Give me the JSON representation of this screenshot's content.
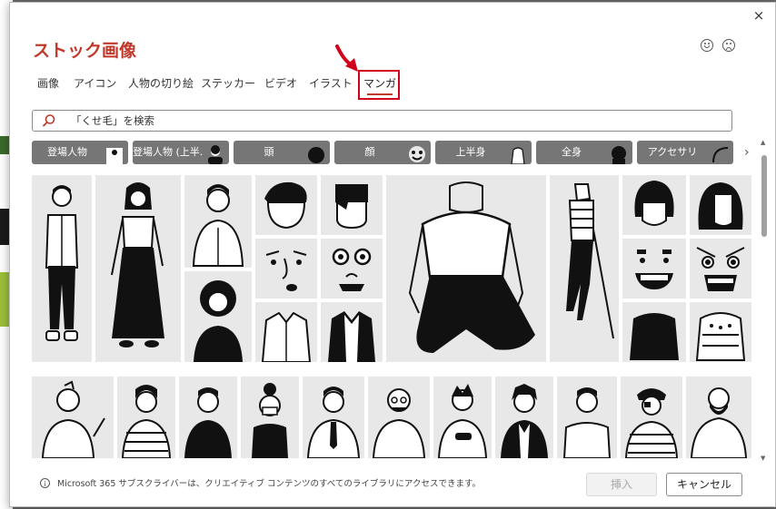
{
  "dialog": {
    "title": "ストック画像",
    "close_glyph": "×",
    "feedback": {
      "happy_icon": "smiley-icon",
      "sad_icon": "frown-icon"
    }
  },
  "tabs": [
    {
      "label": "画像",
      "active": false
    },
    {
      "label": "アイコン",
      "active": false
    },
    {
      "label": "人物の切り絵",
      "active": false
    },
    {
      "label": "ステッカー",
      "active": false
    },
    {
      "label": "ビデオ",
      "active": false
    },
    {
      "label": "イラスト",
      "active": false
    },
    {
      "label": "マンガ",
      "active": true
    }
  ],
  "search": {
    "value": "「くせ毛」を検索",
    "icon": "search-icon"
  },
  "categories": [
    {
      "label": "登場人物"
    },
    {
      "label": "登場人物 (上半..."
    },
    {
      "label": "頭"
    },
    {
      "label": "顔"
    },
    {
      "label": "上半身"
    },
    {
      "label": "全身"
    },
    {
      "label": "アクセサリ"
    }
  ],
  "footer": {
    "info_text": "Microsoft 365 サブスクライバーは、クリエイティブ コンテンツのすべてのライブラリにアクセスできます。",
    "insert_label": "挿入",
    "cancel_label": "キャンセル"
  },
  "colors": {
    "accent": "#c0392b",
    "highlight": "#d0021b",
    "chip_bg": "#767676",
    "tile_bg": "#e8e8e8"
  }
}
